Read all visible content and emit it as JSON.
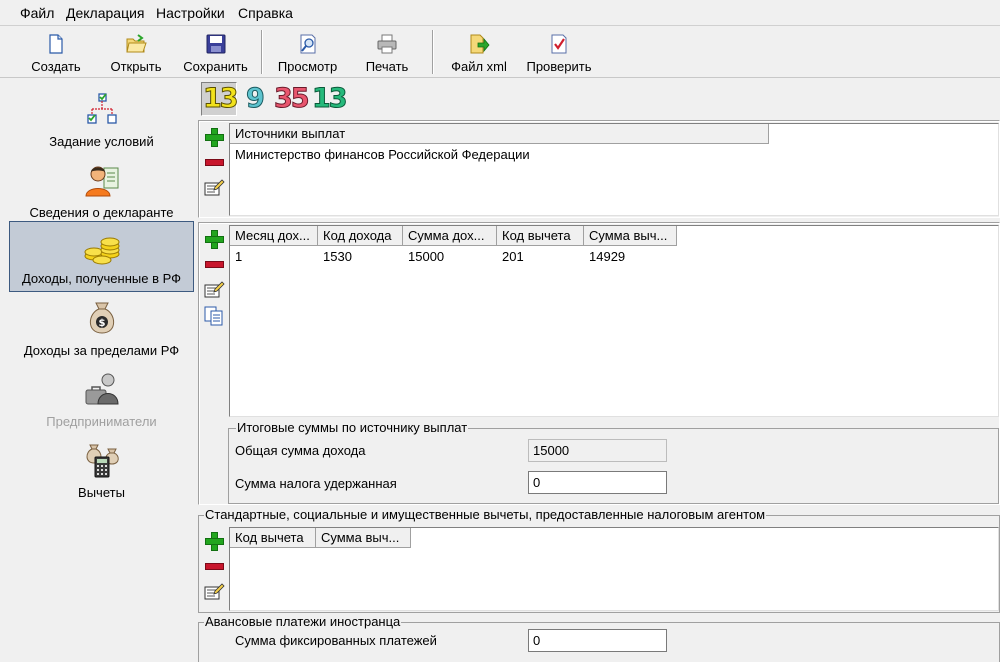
{
  "menu": [
    "Файл",
    "Декларация",
    "Настройки",
    "Справка"
  ],
  "toolbar": {
    "create": "Создать",
    "open": "Открыть",
    "save": "Сохранить",
    "preview": "Просмотр",
    "print": "Печать",
    "xml": "Файл xml",
    "check": "Проверить"
  },
  "sidebar": {
    "items": [
      {
        "label": "Задание условий"
      },
      {
        "label": "Сведения о декларанте"
      },
      {
        "label": "Доходы, полученные в РФ"
      },
      {
        "label": "Доходы за пределами РФ"
      },
      {
        "label": "Предприниматели"
      },
      {
        "label": "Вычеты"
      }
    ],
    "active_index": 2
  },
  "tax_tabs": [
    {
      "label": "13",
      "color": "#f2e21c"
    },
    {
      "label": "9",
      "color": "#5ec4cf"
    },
    {
      "label": "35",
      "color": "#e8566e"
    },
    {
      "label": "13",
      "color": "#26b97b"
    }
  ],
  "sources": {
    "header": "Источники выплат",
    "rows": [
      "Министерство финансов Российской Федерации"
    ]
  },
  "income": {
    "headers": [
      "Месяц дох...",
      "Код дохода",
      "Сумма дох...",
      "Код вычета",
      "Сумма выч..."
    ],
    "rows": [
      [
        "1",
        "1530",
        "15000",
        "201",
        "14929"
      ]
    ]
  },
  "totals": {
    "title": "Итоговые суммы по источнику выплат",
    "total_income_label": "Общая сумма дохода",
    "total_income_value": "15000",
    "tax_withheld_label": "Сумма налога удержанная",
    "tax_withheld_value": "0"
  },
  "deductions": {
    "title": "Стандартные, социальные и имущественные вычеты, предоставленные налоговым агентом",
    "headers": [
      "Код вычета",
      "Сумма выч..."
    ]
  },
  "foreigner": {
    "title": "Авансовые платежи иностранца",
    "fixed_payments_label": "Сумма фиксированных платежей",
    "fixed_payments_value": "0"
  }
}
